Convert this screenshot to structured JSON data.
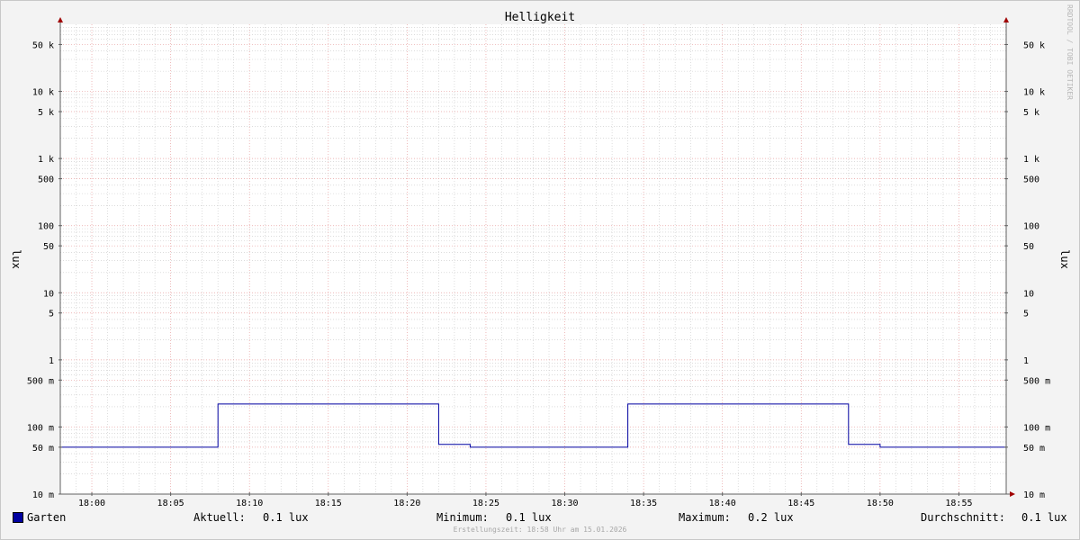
{
  "chart_data": {
    "type": "line",
    "title": "Helligkeit",
    "ylabel": "lux",
    "y_scale": "log",
    "ylim": [
      0.01,
      100000
    ],
    "xlim": [
      "17:58",
      "18:58"
    ],
    "grid": true,
    "x_ticks": [
      "18:00",
      "18:05",
      "18:10",
      "18:15",
      "18:20",
      "18:25",
      "18:30",
      "18:35",
      "18:40",
      "18:45",
      "18:50",
      "18:55"
    ],
    "y_ticks": [
      {
        "value": 0.01,
        "label": "10 m"
      },
      {
        "value": 0.05,
        "label": "50 m"
      },
      {
        "value": 0.1,
        "label": "100 m"
      },
      {
        "value": 0.5,
        "label": "500 m"
      },
      {
        "value": 1,
        "label": "1"
      },
      {
        "value": 5,
        "label": "5"
      },
      {
        "value": 10,
        "label": "10"
      },
      {
        "value": 50,
        "label": "50"
      },
      {
        "value": 100,
        "label": "100"
      },
      {
        "value": 500,
        "label": "500"
      },
      {
        "value": 1000,
        "label": "1 k"
      },
      {
        "value": 5000,
        "label": "5 k"
      },
      {
        "value": 10000,
        "label": "10 k"
      },
      {
        "value": 50000,
        "label": "50 k"
      }
    ],
    "series": [
      {
        "name": "Garten",
        "color": "#0000a0",
        "points": [
          [
            "17:58",
            0.05
          ],
          [
            "18:08",
            0.05
          ],
          [
            "18:08",
            0.22
          ],
          [
            "18:22",
            0.22
          ],
          [
            "18:22",
            0.055
          ],
          [
            "18:24",
            0.055
          ],
          [
            "18:24",
            0.05
          ],
          [
            "18:34",
            0.05
          ],
          [
            "18:34",
            0.22
          ],
          [
            "18:48",
            0.22
          ],
          [
            "18:48",
            0.055
          ],
          [
            "18:50",
            0.055
          ],
          [
            "18:50",
            0.05
          ],
          [
            "18:58",
            0.05
          ]
        ]
      }
    ]
  },
  "legend": {
    "series_name": "Garten",
    "aktuell_label": "Aktuell:",
    "aktuell_value": "0.1 lux",
    "minimum_label": "Minimum:",
    "minimum_value": "0.1 lux",
    "maximum_label": "Maximum:",
    "maximum_value": "0.2 lux",
    "durchschnitt_label": "Durchschnitt:",
    "durchschnitt_value": "0.1 lux"
  },
  "footer": "Erstellungszeit: 18:58 Uhr am 15.01.2026",
  "watermark": "RRDTOOL / TOBI OETIKER",
  "colors": {
    "series": "#0000a0",
    "major_grid": "#e8a0a0",
    "minor_grid": "#c8c8c8",
    "axis": "#606060",
    "arrow": "#a00000"
  }
}
